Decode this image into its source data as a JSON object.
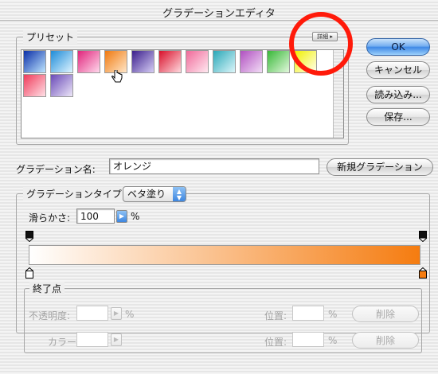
{
  "window": {
    "title": "グラデーションエディタ"
  },
  "presets": {
    "label": "プリセット",
    "menu_button_label": "詳細 ▸",
    "swatches": [
      {
        "name": "blue",
        "from": "#0b2fa8",
        "to": "#bfe6ff"
      },
      {
        "name": "cyan-blue",
        "from": "#1e8cd8",
        "to": "#dff4ff"
      },
      {
        "name": "magenta",
        "from": "#e0267c",
        "to": "#ffd8ec"
      },
      {
        "name": "orange",
        "from": "#f07a10",
        "to": "#ffe6c8"
      },
      {
        "name": "purple",
        "from": "#3a1e8c",
        "to": "#d6cdf5"
      },
      {
        "name": "red",
        "from": "#d8102a",
        "to": "#ffd8de"
      },
      {
        "name": "pink",
        "from": "#f06a9a",
        "to": "#ffe8f0"
      },
      {
        "name": "teal",
        "from": "#2aa8b8",
        "to": "#dcf6fa"
      },
      {
        "name": "violet",
        "from": "#b050c0",
        "to": "#f2dcf6"
      },
      {
        "name": "green",
        "from": "#38b838",
        "to": "#e2f8dc"
      },
      {
        "name": "yellow",
        "from": "#f0f000",
        "to": "#fffff0"
      },
      {
        "name": "rose",
        "from": "#f03a5a",
        "to": "#ffe0e6"
      },
      {
        "name": "lavender",
        "from": "#6a4ab8",
        "to": "#ece6f8"
      }
    ]
  },
  "buttons": {
    "ok": "OK",
    "cancel": "キャンセル",
    "load": "読み込み...",
    "save": "保存...",
    "new_gradient": "新規グラデーション"
  },
  "name_field": {
    "label": "グラデーション名:",
    "value": "オレンジ"
  },
  "gradient_type": {
    "label": "グラデーションタイプ:",
    "selected": "ベタ塗り",
    "smoothness_label": "滑らかさ:",
    "smoothness_value": "100",
    "smoothness_unit": "%"
  },
  "gradient": {
    "start_color": "#ffffff",
    "end_color": "#f57c10"
  },
  "stops": {
    "label": "終了点",
    "opacity_label": "不透明度:",
    "opacity_value": "",
    "opacity_unit": "%",
    "opacity_position_label": "位置:",
    "opacity_position_value": "",
    "opacity_position_unit": "%",
    "opacity_delete": "削除",
    "color_label": "カラー:",
    "color_position_label": "位置:",
    "color_position_value": "",
    "color_position_unit": "%",
    "color_delete": "削除"
  },
  "colors": {
    "highlight_ring": "#ff1a0a",
    "default_button": "#3f88e6"
  }
}
